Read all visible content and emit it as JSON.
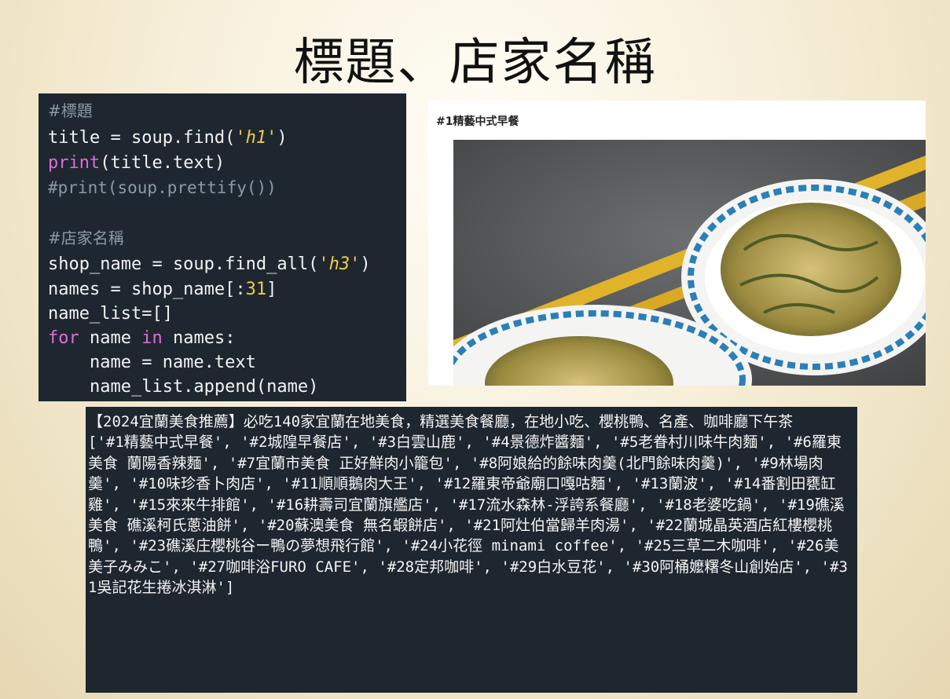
{
  "slide": {
    "title": "標題、店家名稱"
  },
  "code": {
    "lines": [
      "#標題",
      "title = soup.find('h1')",
      "print(title.text)",
      "#print(soup.prettify())",
      "#店家名稱",
      "shop_name = soup.find_all('h3')",
      "names = shop_name[:31]",
      "name_list=[]",
      "for name in names:",
      "    name = name.text",
      "    name_list.append(name)"
    ]
  },
  "webpage": {
    "heading": "#1精藝中式早餐",
    "image": "food-photo"
  },
  "output": {
    "page_title": "【2024宜蘭美食推薦】必吃140家宜蘭在地美食，精選美食餐廳，在地小吃、櫻桃鴨、名產、咖啡廳下午茶",
    "name_list": "['#1精藝中式早餐', '#2城隍早餐店', '#3白雲山鹿', '#4景德炸醬麵', '#5老眷村川味牛肉麵', '#6羅東美食 蘭陽香辣麵', '#7宜蘭市美食 正好鮮肉小籠包', '#8阿娘給的餘味肉羹(北門餘味肉羹)', '#9林場肉羹', '#10味珍香卜肉店', '#11順順鵝肉大王', '#12羅東帝爺廟口嘎咕麵', '#13蘭波', '#14番割田甕缸雞', '#15來來牛排館', '#16耕壽司宜蘭旗艦店', '#17流水森林-浮誇系餐廳', '#18老婆吃鍋', '#19礁溪美食 礁溪柯氏蔥油餅', '#20蘇澳美食 無名蝦餅店', '#21阿灶伯當歸羊肉湯', '#22蘭城晶英酒店紅樓櫻桃鴨', '#23礁溪庄櫻桃谷ー鴨の夢想飛行館', '#24小花徑 minami coffee', '#25三草二木咖啡', '#26美美子みみこ', '#27咖啡浴FURO CAFE', '#28定邦咖啡', '#29白水豆花', '#30阿桶嬤糬冬山創始店', '#31吳記花生捲冰淇淋']"
  }
}
